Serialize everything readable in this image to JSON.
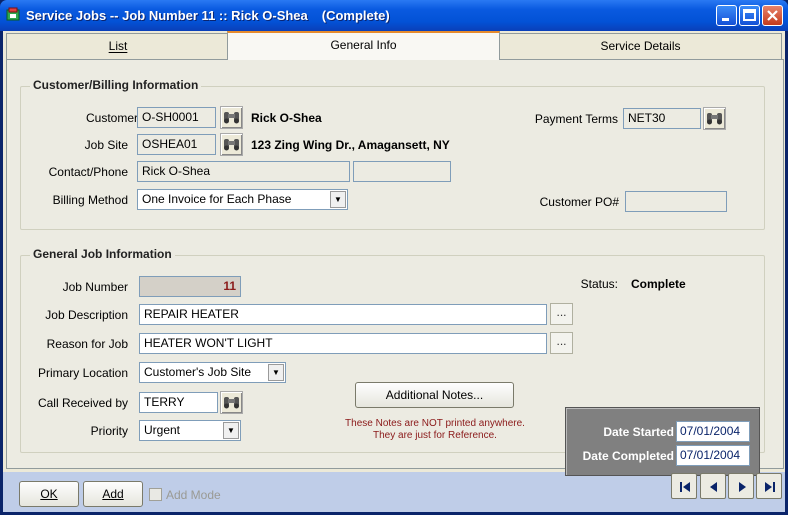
{
  "window": {
    "title": "Service Jobs -- Job Number 11 :: Rick O-Shea",
    "status": "(Complete)"
  },
  "tabs": [
    {
      "label": "List"
    },
    {
      "label": "General Info",
      "active": true
    },
    {
      "label": "Service Details"
    }
  ],
  "customer_billing": {
    "group_title": "Customer/Billing Information",
    "customer_label": "Customer",
    "customer_code": "O-SH0001",
    "customer_name": "Rick O-Shea",
    "job_site_label": "Job Site",
    "job_site_code": "OSHEA01",
    "job_site_address": "123 Zing Wing Dr., Amagansett, NY",
    "contact_label": "Contact/Phone",
    "contact_name": "Rick O-Shea",
    "contact_phone": "",
    "billing_method_label": "Billing Method",
    "billing_method": "One Invoice for Each Phase",
    "payment_terms_label": "Payment Terms",
    "payment_terms": "NET30",
    "customer_po_label": "Customer PO#",
    "customer_po": ""
  },
  "general_job": {
    "group_title": "General Job Information",
    "job_number_label": "Job Number",
    "job_number": "11",
    "status_label": "Status:",
    "status_value": "Complete",
    "job_description_label": "Job Description",
    "job_description": "REPAIR HEATER",
    "reason_label": "Reason for Job",
    "reason": "HEATER WON'T LIGHT",
    "primary_location_label": "Primary Location",
    "primary_location": "Customer's Job Site",
    "call_received_label": "Call Received by",
    "call_received_by": "TERRY",
    "priority_label": "Priority",
    "priority": "Urgent",
    "additional_notes_button": "Additional Notes...",
    "notes_disclaimer_line1": "These Notes are NOT printed anywhere.",
    "notes_disclaimer_line2": "They are just for Reference.",
    "date_started_label": "Date Started",
    "date_started": "07/01/2004",
    "date_completed_label": "Date Completed",
    "date_completed": "07/01/2004"
  },
  "footer": {
    "ok_label": "OK",
    "add_label": "Add",
    "add_mode_label": "Add Mode"
  },
  "colors": {
    "titlebar": "#0352d6",
    "accent_tab": "#e68b2c",
    "note_text": "#8b1a1a",
    "dates_panel": "#808080"
  }
}
